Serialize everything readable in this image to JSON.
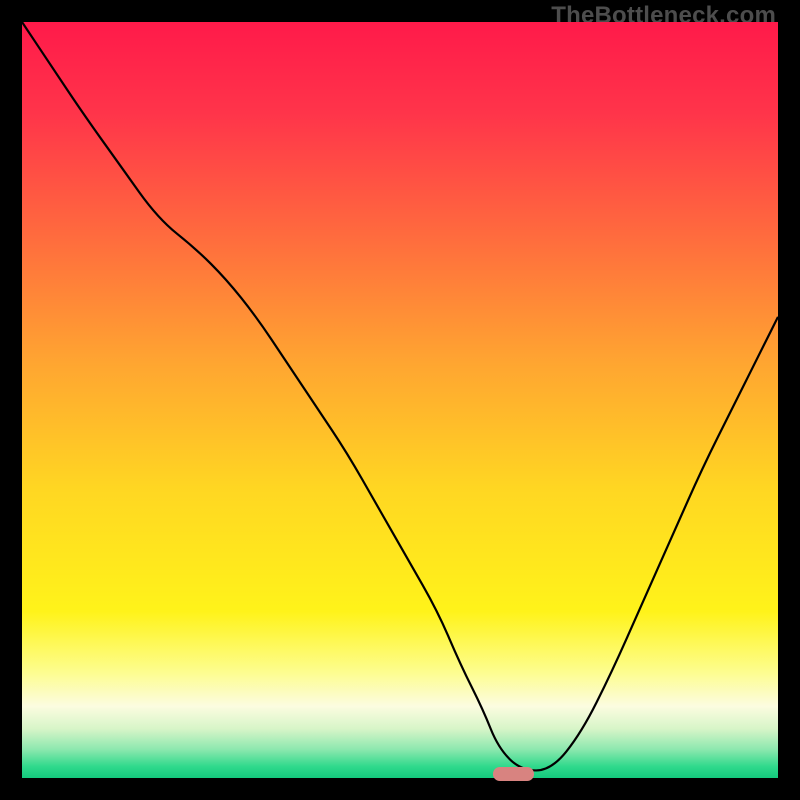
{
  "watermark": "TheBottleneck.com",
  "chart_data": {
    "type": "line",
    "title": "",
    "xlabel": "",
    "ylabel": "",
    "xlim": [
      0,
      100
    ],
    "ylim": [
      0,
      100
    ],
    "grid": false,
    "legend": false,
    "background_gradient": {
      "stops": [
        {
          "pos": 0.0,
          "color": "#ff1a4a"
        },
        {
          "pos": 0.12,
          "color": "#ff344a"
        },
        {
          "pos": 0.28,
          "color": "#ff6a3e"
        },
        {
          "pos": 0.45,
          "color": "#ffa531"
        },
        {
          "pos": 0.62,
          "color": "#ffd722"
        },
        {
          "pos": 0.78,
          "color": "#fff31a"
        },
        {
          "pos": 0.86,
          "color": "#fdfd8f"
        },
        {
          "pos": 0.905,
          "color": "#fcfce0"
        },
        {
          "pos": 0.935,
          "color": "#d7f5c8"
        },
        {
          "pos": 0.962,
          "color": "#8de8af"
        },
        {
          "pos": 0.985,
          "color": "#2fd98c"
        },
        {
          "pos": 1.0,
          "color": "#14c97d"
        }
      ]
    },
    "series": [
      {
        "name": "bottleneck-curve",
        "color": "#000000",
        "width": 2.2,
        "x": [
          0,
          4,
          8,
          13,
          18,
          23,
          27,
          31,
          35,
          39,
          43,
          47,
          51,
          55,
          58,
          61,
          63,
          66,
          70,
          74,
          78,
          82,
          86,
          90,
          94,
          98,
          100
        ],
        "y": [
          100,
          94,
          88,
          81,
          74,
          70,
          66,
          61,
          55,
          49,
          43,
          36,
          29,
          22,
          15,
          9,
          4,
          1,
          1,
          6,
          14,
          23,
          32,
          41,
          49,
          57,
          61
        ]
      }
    ],
    "marker": {
      "name": "optimum-marker",
      "color": "#d88380",
      "x_center": 65,
      "y": 0.5,
      "width_pct": 5.5,
      "height_pct": 1.8
    }
  }
}
